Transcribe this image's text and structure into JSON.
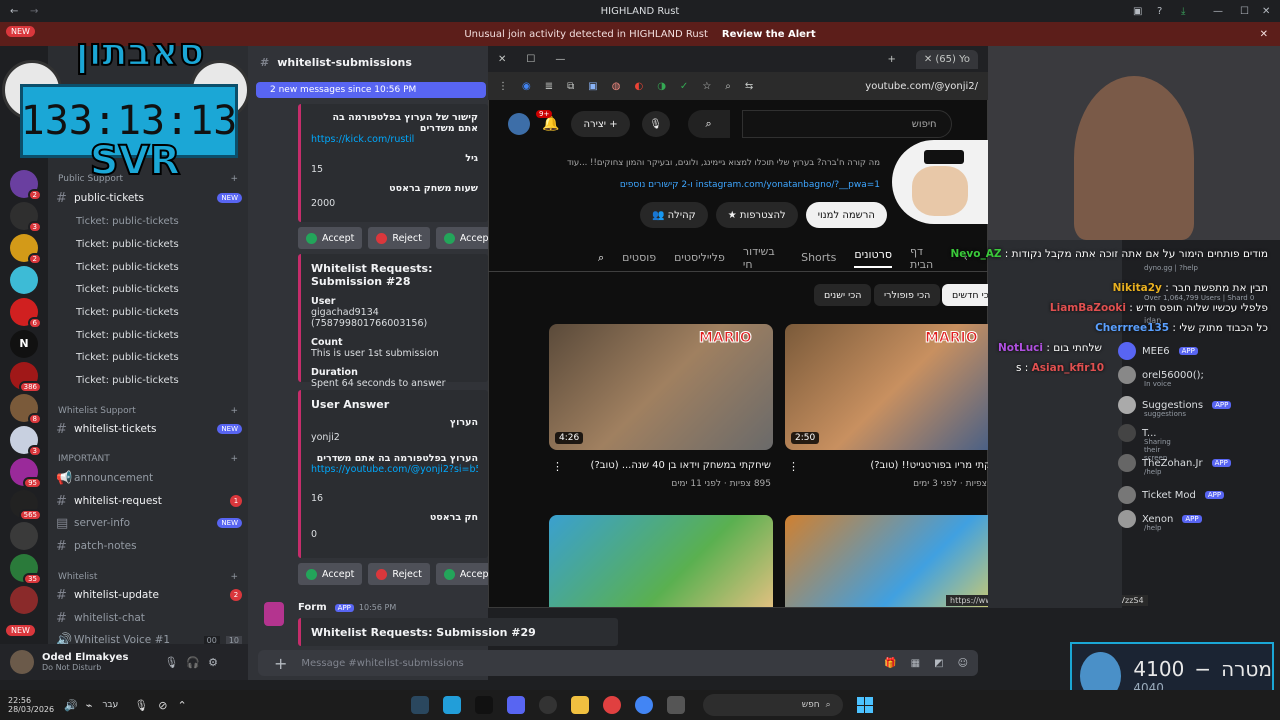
{
  "window": {
    "title": "HIGHLAND Rust"
  },
  "alert": {
    "text": "Unusual join activity detected in HIGHLAND Rust",
    "action": "Review the Alert"
  },
  "overlay": {
    "logo": "סאבתון",
    "timer": "133:13:13",
    "svr": "SVR",
    "new_badge": "NEW",
    "new_badge2": "NEW"
  },
  "servers": [
    {
      "badge": "2"
    },
    {
      "badge": "3"
    },
    {
      "badge": "2"
    },
    {
      "badge": ""
    },
    {
      "badge": "6"
    },
    {
      "badge": ""
    },
    {
      "badge": "386"
    },
    {
      "badge": "8"
    },
    {
      "badge": "3"
    },
    {
      "badge": "95"
    },
    {
      "badge": "565"
    },
    {
      "badge": ""
    },
    {
      "badge": "35"
    },
    {
      "badge": ""
    }
  ],
  "sidebar": {
    "cat_public": "Public Support",
    "public_tickets": "public-tickets",
    "public_tickets_badge": "NEW",
    "threads": [
      "Ticket: public-tickets",
      "Ticket: public-tickets",
      "Ticket: public-tickets",
      "Ticket: public-tickets",
      "Ticket: public-tickets",
      "Ticket: public-tickets",
      "Ticket: public-tickets",
      "Ticket: public-tickets"
    ],
    "cat_whitelist_support": "Whitelist Support",
    "whitelist_tickets": "whitelist-tickets",
    "whitelist_tickets_badge": "NEW",
    "cat_important": "IMPORTANT",
    "announcement": "announcement",
    "whitelist_request": "whitelist-request",
    "whitelist_request_badge": "1",
    "server_info": "server-info",
    "server_info_badge": "NEW",
    "patch_notes": "patch-notes",
    "cat_whitelist": "Whitelist",
    "whitelist_update": "whitelist-update",
    "whitelist_update_badge": "2",
    "whitelist_chat": "whitelist-chat",
    "whitelist_voice": "Whitelist Voice #1",
    "voice_count": "00",
    "voice_limit": "10"
  },
  "user": {
    "name": "Oded Elmakyes",
    "status": "Do Not Disturb"
  },
  "chat": {
    "channel": "whitelist-submissions",
    "new_messages": "2 new messages since 10:56 PM",
    "embed1": {
      "line1": "קישור של הערוץ בפלטפורמה בה אתם משדרים",
      "link": "https://kick.com/rustil",
      "age_label": "גיל",
      "age": "15",
      "hours_label": "שעות משחק בראסט",
      "hours": "2000"
    },
    "accept": "Accept",
    "reject": "Reject",
    "accept_w": "Accept w",
    "embed2": {
      "title": "Whitelist Requests: Submission #28",
      "user_label": "User",
      "user": "gigachad9134 (758799801766003156)",
      "count_label": "Count",
      "count": "This is user 1st submission",
      "duration_label": "Duration",
      "duration": "Spent 64 seconds to answer"
    },
    "embed3": {
      "title": "User Answer",
      "line1": "הערוץ",
      "name": "yonji2",
      "line2": "הערוץ בפלטפורמה בה אתם משדרים",
      "link": "https://youtube.com/@yonji2?si=b52rKOrhl...",
      "age": "16",
      "hours_label": "חק בראסט",
      "hours": "0"
    },
    "form_author": "Form",
    "form_app": "APP",
    "form_time": "10:56 PM",
    "embed4_title": "Whitelist Requests: Submission #29",
    "composer_placeholder": "Message #whitelist-submissions"
  },
  "browser": {
    "tab_title": "(65) Yo",
    "url": "youtube.com/@yonji2/",
    "notif": "9+",
    "create": "יצירה",
    "search_placeholder": "חיפוש",
    "channel_desc": "מה קורה ח'ברה? בערוץ שלי תוכלו למצוא גיימינג, ולוגים, ובעיקר והמון צחוקים!! ...עוד",
    "links": "instagram.com/yonatanbagno/?__pwa=1 ו-2 קישורים נוספים",
    "subscribe": "הרשמה למנוי",
    "join": "להצטרפות",
    "community": "קהילה",
    "tabs": [
      "דף הבית",
      "סרטונים",
      "Shorts",
      "בשידור חי",
      "פלייליסטים",
      "פוסטים"
    ],
    "chips": [
      "הכי חדשים",
      "הכי פופולרי",
      "הכי ישנים"
    ],
    "videos": [
      {
        "title": "שיחקתי מריו בפורטנייט!! (טוב?)",
        "meta": "189 צפיות · לפני 3 ימים",
        "duration": "2:50"
      },
      {
        "title": "שיחקתי במשחק וידאו בן 40 שנה... (טוב?)",
        "meta": "895 צפיות · לפני 11 ימים",
        "duration": "4:26"
      }
    ],
    "status_url": "https://www.youtube.com/watch?v=l279ylVzzS4"
  },
  "stream_chat": [
    {
      "user": "Nevo_AZ",
      "msg": "מודים פותחים הימור על אם אתה זוכה אתה מקבל נקודות",
      "color": "#3ac93a"
    },
    {
      "user": "Nikita2y",
      "msg": "תבין את מתפשת חבר",
      "color": "#e8b020"
    },
    {
      "user": "LiamBaZooki",
      "msg": "פלפלי עכשיו שלוה תופס חדש",
      "color": "#e05050"
    },
    {
      "user": "Cherrree135",
      "msg": "כל הכבוד מתוק שלי",
      "color": "#5aa0ff"
    },
    {
      "user": "NotLuci",
      "msg": "שלחתי בום",
      "color": "#b050e0"
    },
    {
      "user": "Asian_kfir10",
      "msg": "s",
      "color": "#e05050"
    }
  ],
  "members": [
    {
      "name": "MEE6",
      "sub": ""
    },
    {
      "name": "orel56000();",
      "sub": "In voice"
    },
    {
      "name": "Suggestions",
      "sub": "suggestions"
    },
    {
      "name": "T...",
      "sub": "Sharing their screen"
    },
    {
      "name": "TheZohan.Jr",
      "sub": "/help"
    },
    {
      "name": "Ticket Mod",
      "sub": ""
    },
    {
      "name": "Xenon",
      "sub": "/help"
    }
  ],
  "members_top": {
    "dyno": "dyno.gg | ?help",
    "users": "Over 1,064,799 Users | Shard 0",
    "idan": "idan"
  },
  "goal": {
    "label": "מטרה",
    "value": "4100",
    "current": "4040"
  },
  "taskbar": {
    "time": "22:56",
    "date": "28/03/2026",
    "lang": "עבר",
    "search": "חפש"
  },
  "colors": {
    "accent": "#5865f2",
    "overlay_blue": "#1ba7d6",
    "alert_bg": "#5c1e1a"
  }
}
